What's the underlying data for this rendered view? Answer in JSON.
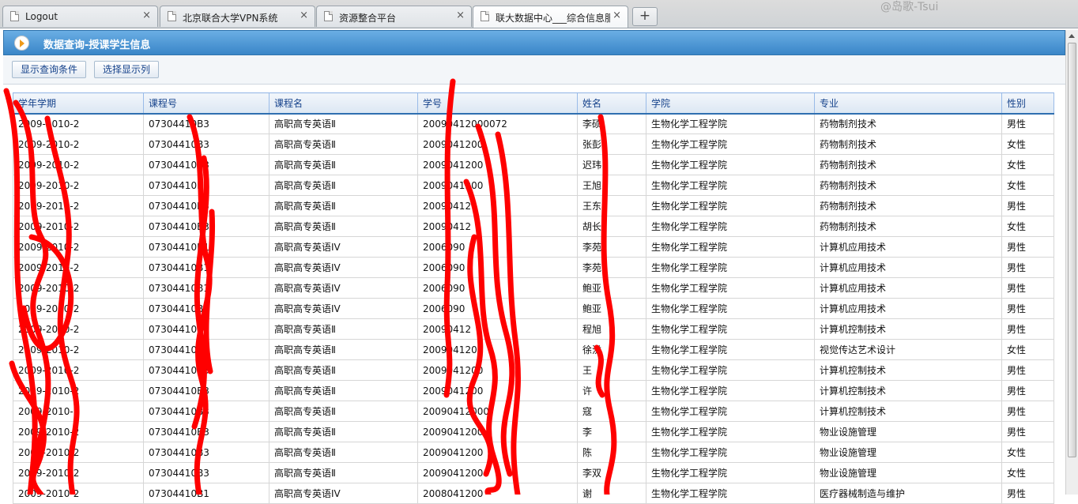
{
  "browser": {
    "tabs": [
      {
        "title": "Logout",
        "close": "×"
      },
      {
        "title": "北京联合大学VPN系统",
        "close": "×"
      },
      {
        "title": "资源整合平台",
        "close": "×"
      },
      {
        "title": "联大数据中心___综合信息服",
        "close": "×"
      }
    ],
    "new_tab": "+",
    "watermark": "@岛歌-Tsui"
  },
  "panel": {
    "title": "数据查询-授课学生信息"
  },
  "toolbar": {
    "show_query": "显示查询条件",
    "select_columns": "选择显示列"
  },
  "table": {
    "headers": [
      "学年学期",
      "课程号",
      "课程名",
      "学号",
      "姓名",
      "学院",
      "专业",
      "性别"
    ],
    "rows": [
      [
        "2009-2010-2",
        "07304410B3",
        "高职高专英语Ⅱ",
        "20090412000072",
        "李硕",
        "生物化学工程学院",
        "药物制剂技术",
        "男性"
      ],
      [
        "2009-2010-2",
        "07304410B3",
        "高职高专英语Ⅱ",
        "2009041200",
        "张彭",
        "生物化学工程学院",
        "药物制剂技术",
        "女性"
      ],
      [
        "2009-2010-2",
        "07304410B3",
        "高职高专英语Ⅱ",
        "2009041200",
        "迟玮",
        "生物化学工程学院",
        "药物制剂技术",
        "女性"
      ],
      [
        "2009-2010-2",
        "07304410B3",
        "高职高专英语Ⅱ",
        "2009041200",
        "王旭",
        "生物化学工程学院",
        "药物制剂技术",
        "女性"
      ],
      [
        "2009-2010-2",
        "07304410B3",
        "高职高专英语Ⅱ",
        "200904120",
        "王东",
        "生物化学工程学院",
        "药物制剂技术",
        "男性"
      ],
      [
        "2009-2010-2",
        "07304410B3",
        "高职高专英语Ⅱ",
        "20090412",
        "胡长",
        "生物化学工程学院",
        "药物制剂技术",
        "女性"
      ],
      [
        "2009-2010-2",
        "07304410B1",
        "高职高专英语IV",
        "2006090",
        "李苑",
        "生物化学工程学院",
        "计算机应用技术",
        "男性"
      ],
      [
        "2009-2010-2",
        "07304410B1",
        "高职高专英语IV",
        "2006090",
        "李苑",
        "生物化学工程学院",
        "计算机应用技术",
        "男性"
      ],
      [
        "2009-2010-2",
        "07304410B1",
        "高职高专英语IV",
        "2006090",
        "鲍亚",
        "生物化学工程学院",
        "计算机应用技术",
        "男性"
      ],
      [
        "2009-2010-2",
        "07304410B1",
        "高职高专英语IV",
        "2006090",
        "鲍亚",
        "生物化学工程学院",
        "计算机应用技术",
        "男性"
      ],
      [
        "2009-2010-2",
        "07304410B3",
        "高职高专英语Ⅱ",
        "20090412",
        "程旭",
        "生物化学工程学院",
        "计算机控制技术",
        "男性"
      ],
      [
        "2009-2010-2",
        "07304410B3",
        "高职高专英语Ⅱ",
        "2009041200",
        "徐洪",
        "生物化学工程学院",
        "视觉传达艺术设计",
        "女性"
      ],
      [
        "2009-2010-2",
        "07304410B3",
        "高职高专英语Ⅱ",
        "2009041200",
        "王",
        "生物化学工程学院",
        "计算机控制技术",
        "男性"
      ],
      [
        "2009-2010-2",
        "07304410B3",
        "高职高专英语Ⅱ",
        "2009041200",
        "许",
        "生物化学工程学院",
        "计算机控制技术",
        "男性"
      ],
      [
        "2009-2010-2",
        "07304410B3",
        "高职高专英语Ⅱ",
        "20090412000",
        "寇",
        "生物化学工程学院",
        "计算机控制技术",
        "男性"
      ],
      [
        "2009-2010-2",
        "07304410B3",
        "高职高专英语Ⅱ",
        "2009041200",
        "李",
        "生物化学工程学院",
        "物业设施管理",
        "男性"
      ],
      [
        "2009-2010-2",
        "07304410B3",
        "高职高专英语Ⅱ",
        "2009041200",
        "陈",
        "生物化学工程学院",
        "物业设施管理",
        "女性"
      ],
      [
        "2009-2010-2",
        "07304410B3",
        "高职高专英语Ⅱ",
        "2009041200",
        "李双",
        "生物化学工程学院",
        "物业设施管理",
        "女性"
      ],
      [
        "2009-2010-2",
        "07304410B1",
        "高职高专英语IV",
        "2008041200",
        "谢",
        "生物化学工程学院",
        "医疗器械制造与维护",
        "男性"
      ]
    ]
  },
  "colors": {
    "header_blue": "#3a86c8",
    "grid_header_text": "#15428b",
    "scribble_red": "#ff0000"
  }
}
